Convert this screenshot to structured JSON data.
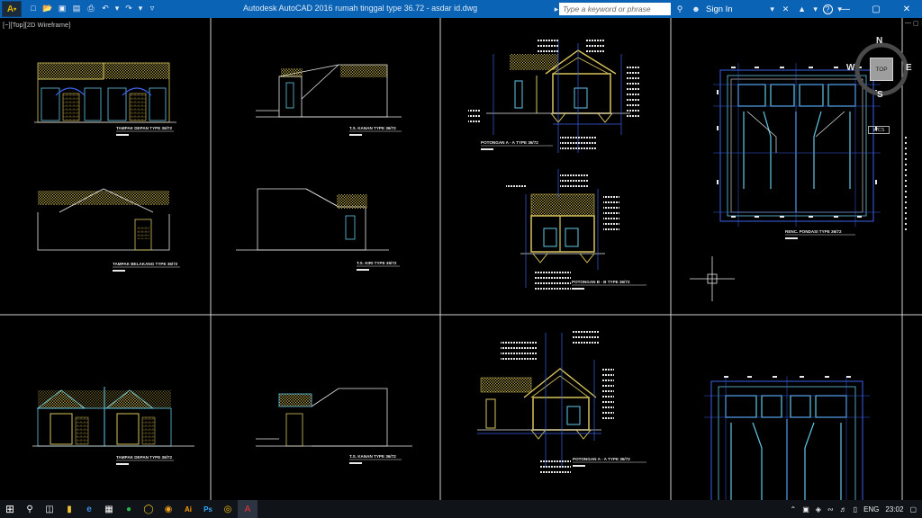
{
  "title_bar": {
    "window_title": "Autodesk AutoCAD 2016    rumah tinggal type 36.72 - asdar id.dwg",
    "search_placeholder": "Type a keyword or phrase",
    "sign_in": "Sign In",
    "quick_access_icons": [
      "new-icon",
      "open-icon",
      "save-icon",
      "save-as-icon",
      "print-icon",
      "undo-icon",
      "redo-icon",
      "workspace-icon"
    ],
    "help_label": "?"
  },
  "viewport": {
    "label": "[−][Top][2D Wireframe]",
    "viewcube": {
      "n": "N",
      "s": "S",
      "e": "E",
      "w": "W",
      "top": "TOP",
      "wcs": "WCS"
    }
  },
  "drawing_titles": {
    "tampak_depan_1": "TAMPAK DEPAN TYPE 36/72",
    "ts_kanan_1": "T.S. KANAN TYPE 36/72",
    "potongan_aa_1": "POTONGAN A - A TYPE 36/72",
    "rencana_pondasi": "RENC. PONDASI TYPE 36/72",
    "tampak_belakang": "TAMPAK BELAKANG TYPE 36/72",
    "ts_kiri": "T.S. KIRI TYPE 36/72",
    "potongan_bb": "POTONGAN B - B TYPE 36/72",
    "tampak_depan_2": "TAMPAK DEPAN TYPE 36/72",
    "ts_kanan_2": "T.S. KANAN TYPE 36/72",
    "potongan_aa_2": "POTONGAN A - A TYPE 36/72"
  },
  "taskbar": {
    "apps": [
      "start-icon",
      "search-icon",
      "task-view-icon",
      "file-explorer-icon",
      "edge-icon",
      "store-icon",
      "app-icon-1",
      "app-icon-2",
      "app-icon-3",
      "illustrator-icon",
      "photoshop-icon",
      "chrome-icon",
      "autocad-icon"
    ],
    "language": "ENG",
    "time": "23:02"
  },
  "colors": {
    "title_bar": "#0a63b4",
    "drawing_yellow": "#d8c45a",
    "drawing_blue": "#3a62e8",
    "drawing_cyan": "#62c8e8",
    "frame_line": "#d0d0d0"
  }
}
